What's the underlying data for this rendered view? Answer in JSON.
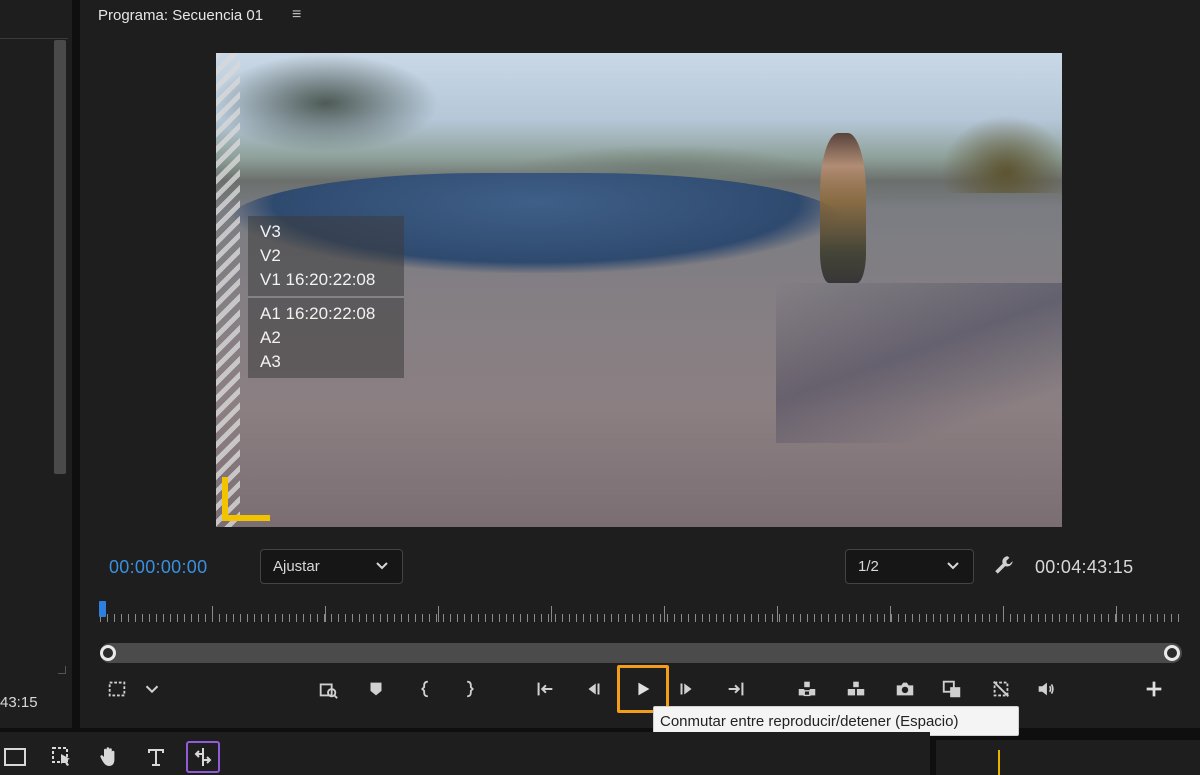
{
  "left_panel": {
    "timecode": "43:15"
  },
  "monitor": {
    "title": "Programa: Secuencia 01",
    "menu_icon": "≡",
    "overlay": {
      "video_tracks": [
        "V3",
        "V2",
        "V1 16:20:22:08"
      ],
      "audio_tracks": [
        "A1 16:20:22:08",
        "A2",
        "A3"
      ]
    },
    "playhead_timecode": "00:00:00:00",
    "duration_timecode": "00:04:43:15",
    "zoom": {
      "selected": "Ajustar"
    },
    "resolution": {
      "selected": "1/2"
    },
    "tooltip": "Conmutar entre reproducir/detener (Espacio)",
    "colors": {
      "accent_blue": "#3b8fe0",
      "highlight_orange": "#f29d1b",
      "guide_yellow": "#f2c300",
      "active_tool_purple": "#8f5bd6"
    },
    "icons": {
      "transport": [
        "safe-margins-icon",
        "chevron-down-icon",
        "lift-export-icon",
        "add-marker-icon",
        "mark-in-icon",
        "mark-out-icon",
        "go-to-in-icon",
        "step-back-icon",
        "play-icon",
        "step-forward-icon",
        "go-to-out-icon",
        "lift-icon",
        "extract-icon",
        "export-frame-icon",
        "comparison-view-icon",
        "proxy-toggle-icon",
        "volume-icon",
        "add-button-icon"
      ],
      "bottom_tools": [
        "rectangle-icon",
        "selection-tool-icon",
        "hand-icon",
        "type-tool-icon",
        "sequence-tool-icon"
      ]
    }
  }
}
